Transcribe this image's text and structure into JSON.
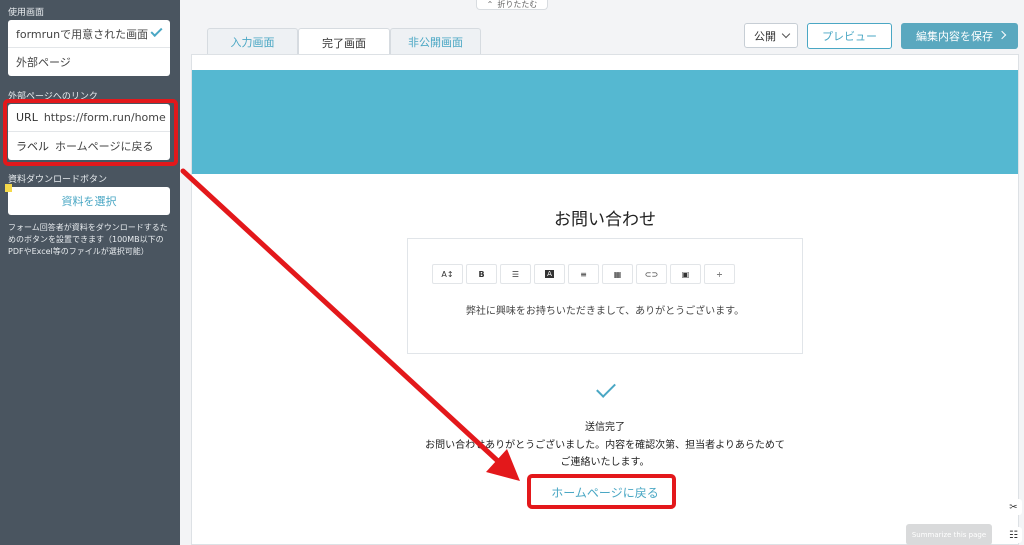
{
  "collapse": {
    "label": "折りたたむ",
    "icon": "chevron-up-icon"
  },
  "sidebar": {
    "screen_section_label": "使用画面",
    "screen_options": [
      {
        "label": "formrunで用意された画面",
        "selected": true
      },
      {
        "label": "外部ページ",
        "selected": false
      }
    ],
    "external_link_label": "外部ページへのリンク",
    "url": {
      "key": "URL",
      "value": "https://form.run/home"
    },
    "label": {
      "key": "ラベル",
      "value": "ホームページに戻る"
    },
    "download_label": "資料ダウンロードボタン",
    "select_button": "資料を選択",
    "download_note": "フォーム回答者が資料をダウンロードするためのボタンを設置できます（100MB以下のPDFやExcel等のファイルが選択可能）"
  },
  "tabs": [
    {
      "label": "入力画面",
      "active": false
    },
    {
      "label": "完了画面",
      "active": true
    },
    {
      "label": "非公開画面",
      "active": false
    }
  ],
  "header": {
    "visibility_value": "公開",
    "preview_button": "プレビュー",
    "save_button": "編集内容を保存"
  },
  "form": {
    "title": "お問い合わせ",
    "editor_text": "弊社に興味をお持ちいただきまして、ありがとうございます。",
    "toolbar": [
      {
        "name": "font-size-icon",
        "glyph": "A↕"
      },
      {
        "name": "bold-icon",
        "glyph": "B"
      },
      {
        "name": "bullet-list-icon",
        "glyph": "☰"
      },
      {
        "name": "text-color-icon",
        "glyph": "A"
      },
      {
        "name": "align-left-icon",
        "glyph": "≡"
      },
      {
        "name": "table-icon",
        "glyph": "▦"
      },
      {
        "name": "link-icon",
        "glyph": "⊂⊃"
      },
      {
        "name": "image-icon",
        "glyph": "▣"
      },
      {
        "name": "strikethrough-icon",
        "glyph": "÷"
      }
    ],
    "done_title": "送信完了",
    "done_message": "お問い合わせありがとうございました。内容を確認次第、担当者よりあらためてご連絡いたします。",
    "home_link": "ホームページに戻る"
  },
  "overlay": {
    "summarize_button": "Summarize this page",
    "annotation_color": "#e3181b",
    "accent_color": "#4aa7c4",
    "banner_color": "#55b8d1",
    "sidebar_color": "#4a5560"
  }
}
